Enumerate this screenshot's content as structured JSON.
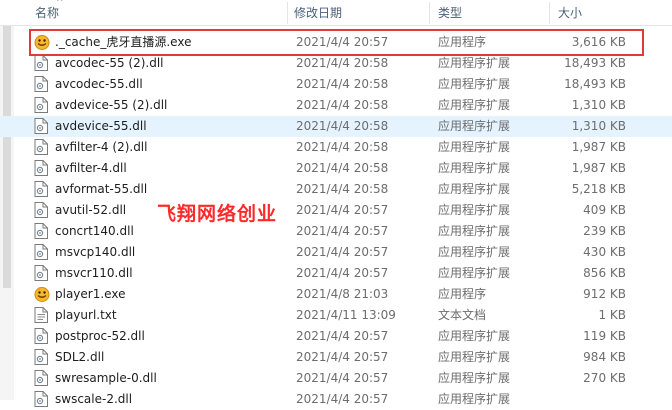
{
  "columns": {
    "name": "名称",
    "date": "修改日期",
    "type": "类型",
    "size": "大小"
  },
  "watermark": "飞翔网络创业",
  "files": [
    {
      "name": "._cache_虎牙直播源.exe",
      "date": "2021/4/4 20:57",
      "type": "应用程序",
      "size": "3,616 KB",
      "icon": "app-icon"
    },
    {
      "name": "avcodec-55 (2).dll",
      "date": "2021/4/4 20:58",
      "type": "应用程序扩展",
      "size": "18,493 KB",
      "icon": "dll-file-icon"
    },
    {
      "name": "avcodec-55.dll",
      "date": "2021/4/4 20:58",
      "type": "应用程序扩展",
      "size": "18,493 KB",
      "icon": "dll-file-icon"
    },
    {
      "name": "avdevice-55 (2).dll",
      "date": "2021/4/4 20:58",
      "type": "应用程序扩展",
      "size": "1,310 KB",
      "icon": "dll-file-icon"
    },
    {
      "name": "avdevice-55.dll",
      "date": "2021/4/4 20:58",
      "type": "应用程序扩展",
      "size": "1,310 KB",
      "icon": "dll-file-icon"
    },
    {
      "name": "avfilter-4 (2).dll",
      "date": "2021/4/4 20:58",
      "type": "应用程序扩展",
      "size": "1,987 KB",
      "icon": "dll-file-icon"
    },
    {
      "name": "avfilter-4.dll",
      "date": "2021/4/4 20:58",
      "type": "应用程序扩展",
      "size": "1,987 KB",
      "icon": "dll-file-icon"
    },
    {
      "name": "avformat-55.dll",
      "date": "2021/4/4 20:58",
      "type": "应用程序扩展",
      "size": "5,218 KB",
      "icon": "dll-file-icon"
    },
    {
      "name": "avutil-52.dll",
      "date": "2021/4/4 20:57",
      "type": "应用程序扩展",
      "size": "409 KB",
      "icon": "dll-file-icon"
    },
    {
      "name": "concrt140.dll",
      "date": "2021/4/4 20:57",
      "type": "应用程序扩展",
      "size": "239 KB",
      "icon": "dll-file-icon"
    },
    {
      "name": "msvcp140.dll",
      "date": "2021/4/4 20:57",
      "type": "应用程序扩展",
      "size": "430 KB",
      "icon": "dll-file-icon"
    },
    {
      "name": "msvcr110.dll",
      "date": "2021/4/4 20:57",
      "type": "应用程序扩展",
      "size": "856 KB",
      "icon": "dll-file-icon"
    },
    {
      "name": "player1.exe",
      "date": "2021/4/8 21:03",
      "type": "应用程序",
      "size": "912 KB",
      "icon": "app-icon"
    },
    {
      "name": "playurl.txt",
      "date": "2021/4/11 13:09",
      "type": "文本文档",
      "size": "1 KB",
      "icon": "text-file-icon"
    },
    {
      "name": "postproc-52.dll",
      "date": "2021/4/4 20:57",
      "type": "应用程序扩展",
      "size": "119 KB",
      "icon": "dll-file-icon"
    },
    {
      "name": "SDL2.dll",
      "date": "2021/4/4 20:57",
      "type": "应用程序扩展",
      "size": "984 KB",
      "icon": "dll-file-icon"
    },
    {
      "name": "swresample-0.dll",
      "date": "2021/4/4 20:57",
      "type": "应用程序扩展",
      "size": "270 KB",
      "icon": "dll-file-icon"
    },
    {
      "name": "swscale-2.dll",
      "date": "2021/4/4 20:57",
      "type": "应用程序扩展",
      "size": "",
      "icon": "dll-file-icon"
    }
  ],
  "hovered_row": 4,
  "highlighted_row": 0,
  "colors": {
    "highlight_border": "#e23a3a",
    "watermark": "#ff2a2a",
    "hover_row": "#e5f3ff",
    "header_text": "#4c607a"
  }
}
